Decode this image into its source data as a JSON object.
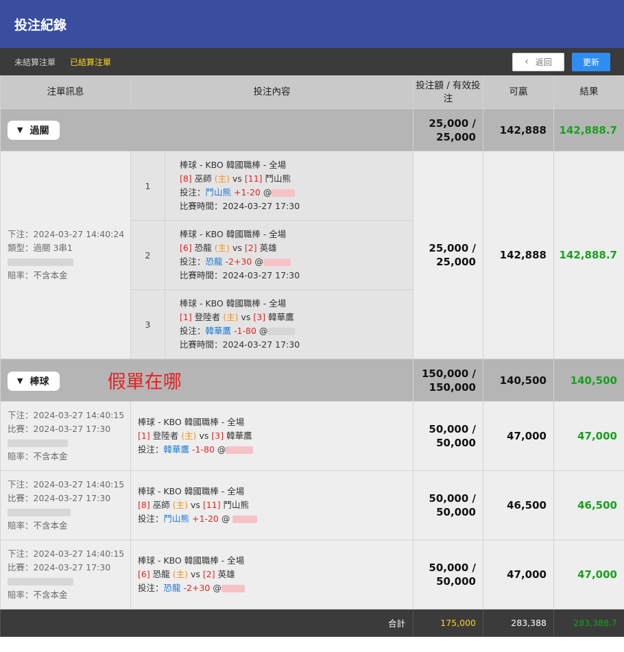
{
  "header": {
    "title": "投注紀錄"
  },
  "tabs": {
    "unsettled": "未結算注單",
    "settled": "已結算注單"
  },
  "buttons": {
    "back": "返回",
    "refresh": "更新"
  },
  "columns": {
    "info": "注單訊息",
    "content": "投注內容",
    "amount": "投注額 / 有效投注",
    "win": "可贏",
    "result": "結果"
  },
  "parlay_group": {
    "label": "過關",
    "amount": "25,000 /",
    "amount2": "25,000",
    "win": "142,888",
    "result": "142,888.7"
  },
  "parlay": {
    "placed": "下注：2024-03-27 14:40:24",
    "type": "類型：過關 3串1",
    "odds_note": "賠率：不含本金",
    "amount": "25,000 /",
    "amount2": "25,000",
    "win": "142,888",
    "result": "142,888.7",
    "legs": [
      {
        "no": "1",
        "league": "棒球 - KBO 韓國職棒 - 全場",
        "home_no": "[8]",
        "home": "巫師",
        "home_tag": "(主)",
        "vs": "vs",
        "away_no": "[11]",
        "away": "鬥山熊",
        "bet_label": "投注：",
        "bet_team": "鬥山熊",
        "bet_line": "+1-20",
        "at": "@",
        "time": "比賽時間：2024-03-27 17:30"
      },
      {
        "no": "2",
        "league": "棒球 - KBO 韓國職棒 - 全場",
        "home_no": "[6]",
        "home": "恐龍",
        "home_tag": "(主)",
        "vs": "vs",
        "away_no": "[2]",
        "away": "英雄",
        "bet_label": "投注：",
        "bet_team": "恐龍",
        "bet_line": "-2+30",
        "at": "@",
        "time": "比賽時間：2024-03-27 17:30"
      },
      {
        "no": "3",
        "league": "棒球 - KBO 韓國職棒 - 全場",
        "home_no": "[1]",
        "home": "登陸者",
        "home_tag": "(主)",
        "vs": "vs",
        "away_no": "[3]",
        "away": "韓華鷹",
        "bet_label": "投注：",
        "bet_team": "韓華鷹",
        "bet_line": "-1-80",
        "at": "@",
        "time": "比賽時間：2024-03-27 17:30"
      }
    ]
  },
  "baseball_group": {
    "label": "棒球",
    "annotation": "假單在哪",
    "amount": "150,000 /",
    "amount2": "150,000",
    "win": "140,500",
    "result": "140,500"
  },
  "singles": [
    {
      "placed": "下注：2024-03-27 14:40:15",
      "match": "比賽：2024-03-27 17:30",
      "odds_note": "賠率：不含本金",
      "league": "棒球 - KBO 韓國職棒 - 全場",
      "home_no": "[1]",
      "home": "登陸者",
      "home_tag": "(主)",
      "vs": "vs",
      "away_no": "[3]",
      "away": "韓華鷹",
      "bet_label": "投注：",
      "bet_team": "韓華鷹",
      "bet_line": "-1-80",
      "at": "@",
      "amount": "50,000 /",
      "amount2": "50,000",
      "win": "47,000",
      "result": "47,000"
    },
    {
      "placed": "下注：2024-03-27 14:40:15",
      "match": "比賽：2024-03-27 17:30",
      "odds_note": "賠率：不含本金",
      "league": "棒球 - KBO 韓國職棒 - 全場",
      "home_no": "[8]",
      "home": "巫師",
      "home_tag": "(主)",
      "vs": "vs",
      "away_no": "[11]",
      "away": "鬥山熊",
      "bet_label": "投注：",
      "bet_team": "鬥山熊",
      "bet_line": "+1-20",
      "at": "@",
      "amount": "50,000 /",
      "amount2": "50,000",
      "win": "46,500",
      "result": "46,500"
    },
    {
      "placed": "下注：2024-03-27 14:40:15",
      "match": "比賽：2024-03-27 17:30",
      "odds_note": "賠率：不含本金",
      "league": "棒球 - KBO 韓國職棒 - 全場",
      "home_no": "[6]",
      "home": "恐龍",
      "home_tag": "(主)",
      "vs": "vs",
      "away_no": "[2]",
      "away": "英雄",
      "bet_label": "投注：",
      "bet_team": "恐龍",
      "bet_line": "-2+30",
      "at": "@",
      "amount": "50,000 /",
      "amount2": "50,000",
      "win": "47,000",
      "result": "47,000"
    }
  ],
  "totals": {
    "label": "合計",
    "amount": "175,000",
    "win": "283,388",
    "result": "283,388.7"
  },
  "colors": {
    "header": "#3a4ea0",
    "active_tab": "#ffd51a",
    "refresh": "#2f8cf0",
    "win_green": "#17a11d",
    "team_red": "#e82020",
    "home_orange": "#f39019",
    "bet_blue": "#1f7ad6"
  }
}
